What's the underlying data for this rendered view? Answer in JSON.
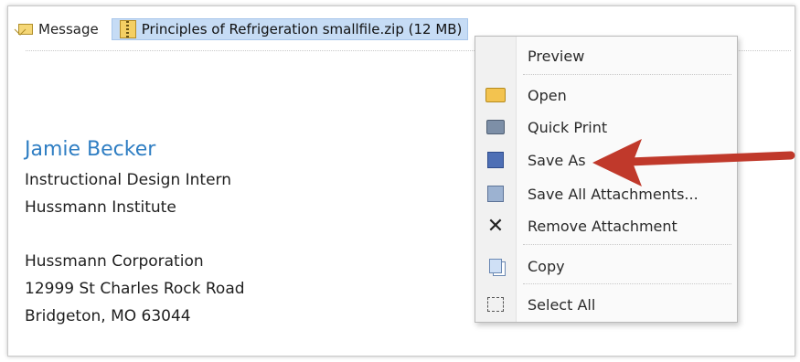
{
  "tabs": {
    "message_label": "Message",
    "attachment_label": "Principles of Refrigeration smallfile.zip (12 MB)"
  },
  "signature": {
    "name": "Jamie Becker",
    "title": "Instructional Design Intern",
    "org": "Hussmann Institute",
    "company": "Hussmann Corporation",
    "street": "12999 St Charles Rock Road",
    "city": "Bridgeton, MO 63044"
  },
  "context_menu": {
    "preview": "Preview",
    "open": "Open",
    "quick_print": "Quick Print",
    "save_as": "Save As",
    "save_all": "Save All Attachments...",
    "remove": "Remove Attachment",
    "copy": "Copy",
    "select_all": "Select All"
  },
  "icons": {
    "message": "envelope-icon",
    "attachment": "zip-file-icon",
    "open": "open-folder-icon",
    "print": "printer-icon",
    "save_as": "save-as-icon",
    "save_all": "save-all-icon",
    "remove": "x-icon",
    "copy": "copy-icon",
    "select_all": "select-all-icon"
  },
  "colors": {
    "accent_name": "#2f7ec3",
    "attachment_highlight": "#c6dcf5",
    "annotation_arrow": "#c0392b"
  }
}
